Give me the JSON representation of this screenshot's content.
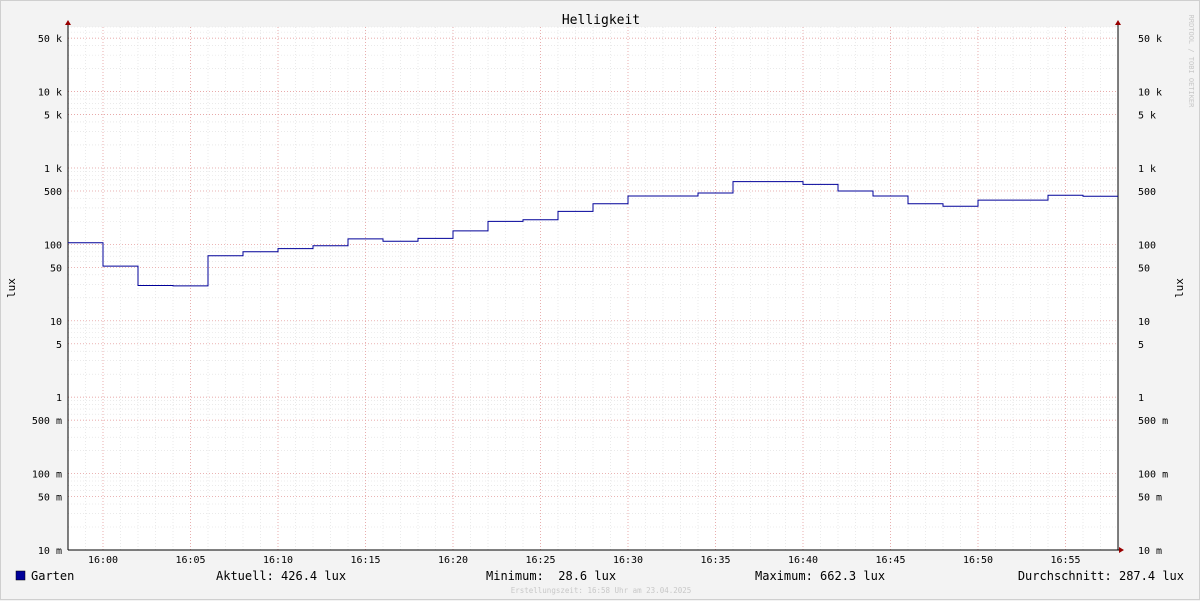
{
  "chart_data": {
    "type": "line",
    "title": "Helligkeit",
    "ylabel": "lux",
    "yscale": "log",
    "ylim": [
      0.01,
      70000
    ],
    "xlim": [
      "15:58",
      "16:58"
    ],
    "x_ticks": [
      "16:00",
      "16:05",
      "16:10",
      "16:15",
      "16:20",
      "16:25",
      "16:30",
      "16:35",
      "16:40",
      "16:45",
      "16:50",
      "16:55"
    ],
    "y_tick_labels": [
      {
        "value": 50000,
        "label": "50 k"
      },
      {
        "value": 10000,
        "label": "10 k"
      },
      {
        "value": 5000,
        "label": "5 k"
      },
      {
        "value": 1000,
        "label": "1 k"
      },
      {
        "value": 500,
        "label": "500"
      },
      {
        "value": 100,
        "label": "100"
      },
      {
        "value": 50,
        "label": "50"
      },
      {
        "value": 10,
        "label": "10"
      },
      {
        "value": 5,
        "label": "5"
      },
      {
        "value": 1,
        "label": "1"
      },
      {
        "value": 0.5,
        "label": "500 m"
      },
      {
        "value": 0.1,
        "label": "100 m"
      },
      {
        "value": 0.05,
        "label": "50 m"
      },
      {
        "value": 0.01,
        "label": "10 m"
      }
    ],
    "grid": true,
    "series": [
      {
        "name": "Garten",
        "color": "#000099",
        "step": true,
        "points": [
          {
            "x": "15:58",
            "y": 105
          },
          {
            "x": "16:00",
            "y": 52
          },
          {
            "x": "16:02",
            "y": 29
          },
          {
            "x": "16:04",
            "y": 28.6
          },
          {
            "x": "16:06",
            "y": 71
          },
          {
            "x": "16:08",
            "y": 80
          },
          {
            "x": "16:10",
            "y": 88
          },
          {
            "x": "16:12",
            "y": 96
          },
          {
            "x": "16:14",
            "y": 118
          },
          {
            "x": "16:16",
            "y": 110
          },
          {
            "x": "16:18",
            "y": 120
          },
          {
            "x": "16:20",
            "y": 150
          },
          {
            "x": "16:22",
            "y": 200
          },
          {
            "x": "16:24",
            "y": 210
          },
          {
            "x": "16:26",
            "y": 270
          },
          {
            "x": "16:28",
            "y": 340
          },
          {
            "x": "16:30",
            "y": 430
          },
          {
            "x": "16:32",
            "y": 430
          },
          {
            "x": "16:34",
            "y": 470
          },
          {
            "x": "16:36",
            "y": 662.3
          },
          {
            "x": "16:40",
            "y": 610
          },
          {
            "x": "16:42",
            "y": 500
          },
          {
            "x": "16:44",
            "y": 430
          },
          {
            "x": "16:46",
            "y": 340
          },
          {
            "x": "16:48",
            "y": 315
          },
          {
            "x": "16:50",
            "y": 380
          },
          {
            "x": "16:54",
            "y": 440
          },
          {
            "x": "16:56",
            "y": 426.4
          },
          {
            "x": "16:58",
            "y": 426.4
          }
        ]
      }
    ],
    "legend": {
      "series_label": "Garten",
      "current": "Aktuell: 426.4 lux",
      "minimum": "Minimum:  28.6 lux",
      "maximum": "Maximum: 662.3 lux",
      "average": "Durchschnitt: 287.4 lux"
    },
    "footer": "Erstellungszeit: 16:58 Uhr am 23.04.2025",
    "watermark": "RRDTOOL / TOBI OETIKER",
    "colors": {
      "background": "#f3f3f3",
      "canvas": "#ffffff",
      "minor_grid": "#dddddd",
      "major_grid": "#e8a0a0",
      "axis_arrow": "#990000",
      "line": "#000099"
    }
  }
}
